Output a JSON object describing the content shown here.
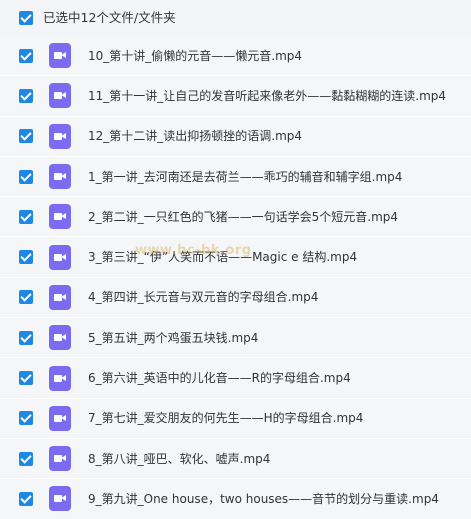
{
  "header": {
    "label": "已选中12个文件/文件夹"
  },
  "files": [
    {
      "name": "10_第十讲_偷懒的元音——懒元音.mp4"
    },
    {
      "name": "11_第十一讲_让自己的发音听起来像老外——黏黏糊糊的连读.mp4"
    },
    {
      "name": "12_第十二讲_读出抑扬顿挫的语调.mp4"
    },
    {
      "name": "1_第一讲_去河南还是去荷兰——乖巧的辅音和辅字组.mp4"
    },
    {
      "name": "2_第二讲_一只红色的飞猪——一句话学会5个短元音.mp4"
    },
    {
      "name": "3_第三讲_“伊”人笑而不语——Magic e 结构.mp4"
    },
    {
      "name": "4_第四讲_长元音与双元音的字母组合.mp4"
    },
    {
      "name": "5_第五讲_两个鸡蛋五块钱.mp4"
    },
    {
      "name": "6_第六讲_英语中的儿化音——R的字母组合.mp4"
    },
    {
      "name": "7_第七讲_爱交朋友的何先生——H的字母组合.mp4"
    },
    {
      "name": "8_第八讲_哑巴、软化、嘘声.mp4"
    },
    {
      "name": "9_第九讲_One house，two houses——音节的划分与重读.mp4"
    }
  ],
  "watermark": "www.bc-bk.org",
  "colors": {
    "checkbox": "#1e88e5",
    "file_icon": "#7c6af0",
    "row_bg": "#f5f6f8",
    "header_bg": "#f3f5f9"
  },
  "icons": {
    "checkbox": "checkbox-checked-icon",
    "file": "video-file-icon"
  }
}
